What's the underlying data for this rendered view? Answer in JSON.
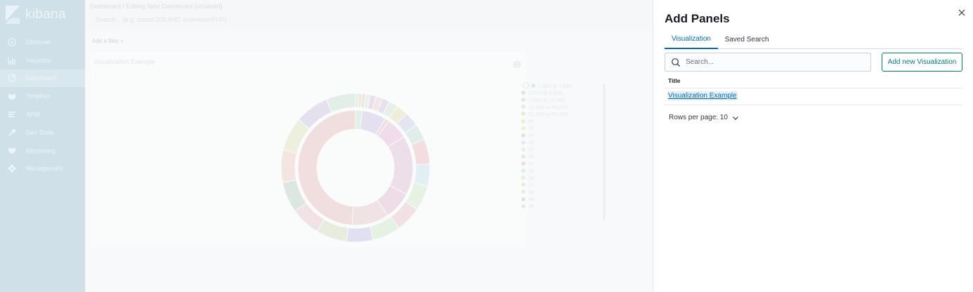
{
  "app": {
    "logo_text": "kibana"
  },
  "sidebar": {
    "items": [
      {
        "label": "Discover",
        "icon": "compass-icon"
      },
      {
        "label": "Visualize",
        "icon": "bar-chart-icon"
      },
      {
        "label": "Dashboard",
        "icon": "dashboard-icon",
        "active": true
      },
      {
        "label": "Timelion",
        "icon": "timelion-icon"
      },
      {
        "label": "APM",
        "icon": "apm-icon"
      },
      {
        "label": "Dev Tools",
        "icon": "wrench-icon"
      },
      {
        "label": "Monitoring",
        "icon": "heartbeat-icon"
      },
      {
        "label": "Management",
        "icon": "gear-icon"
      }
    ]
  },
  "main": {
    "breadcrumb": "Dashboard / Editing New Dashboard (unsaved)",
    "query_placeholder": "Search... (e.g. status:200 AND extension:PHP)",
    "add_filter": "Add a filter +",
    "panel_title": "Visualization Example",
    "legend": [
      "1,000 to 2,999",
      "3,000 to 6,999",
      "7,000 to 14,999",
      "15,000 to 30,000",
      "31,000 to 50,000",
      "85",
      "20",
      "40",
      "35",
      "30",
      "26",
      "27",
      "33",
      "39",
      "21",
      "23",
      "36",
      "28"
    ]
  },
  "flyout": {
    "title": "Add Panels",
    "tabs": [
      "Visualization",
      "Saved Search"
    ],
    "search_placeholder": "Search...",
    "add_button_label": "Add new Visualization",
    "column_title": "Title",
    "rows": [
      "Visualization Example"
    ],
    "rows_per_page": "Rows per page: 10"
  },
  "colors": {
    "accent": "#006bb4",
    "add_button": "#017d73",
    "sidebar_bg": "#cfe0e8"
  }
}
